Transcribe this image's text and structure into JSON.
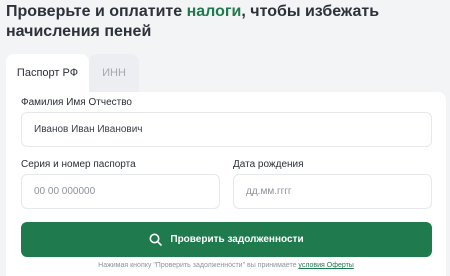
{
  "headline": {
    "before": "Проверьте и оплатите ",
    "accent": "налоги",
    "after": ", чтобы избежать начисления пеней"
  },
  "tabs": [
    {
      "label": "Паспорт РФ",
      "active": true
    },
    {
      "label": "ИНН",
      "active": false
    }
  ],
  "form": {
    "fio_label": "Фамилия Имя Отчество",
    "fio_value": "Иванов Иван Иванович",
    "passport_label": "Серия и номер паспорта",
    "passport_placeholder": "00 00 000000",
    "birth_label": "Дата рождения",
    "birth_placeholder": "дд.мм.гггг"
  },
  "button": {
    "label": "Проверить задолженности",
    "icon": "search-icon"
  },
  "footer": {
    "note_text": "Нажимая кнопку \"Проверить задолженности\" вы принимаете ",
    "link_text": "условия Оферты"
  },
  "colors": {
    "accent": "#1f7a4d",
    "background": "#f3f4f6"
  }
}
